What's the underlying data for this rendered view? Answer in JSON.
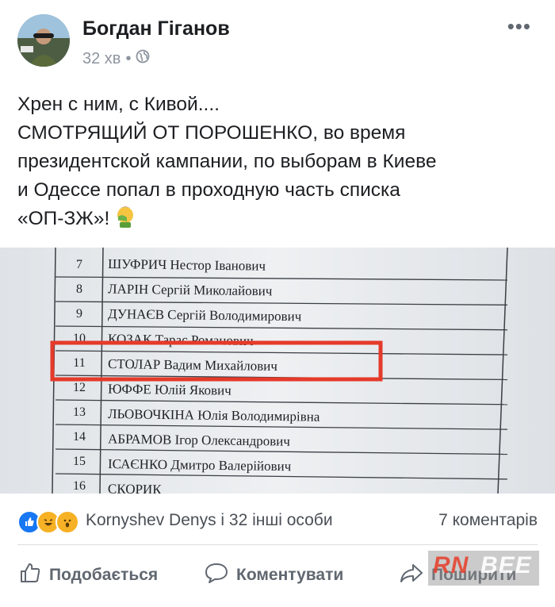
{
  "post": {
    "author": "Богдан Гіганов",
    "time": "32 хв",
    "separator": "•",
    "privacy_icon": "globe-icon",
    "more_label": "•••",
    "text_lines": [
      "Хрен с ним, с Кивой....",
      "СМОТРЯЩИЙ ОТ ПОРОШЕНКО, во время",
      "президентской кампании, по выборам в Киеве",
      "и Одессе попал в проходную часть списка",
      "«ОП-ЗЖ»!"
    ],
    "emoji_icon": "facepalm-emoji-icon"
  },
  "photo": {
    "rows": [
      {
        "num": "7",
        "name": "ШУФРИЧ Нестор Іванович"
      },
      {
        "num": "8",
        "name": "ЛАРІН Сергій Миколайович"
      },
      {
        "num": "9",
        "name": "ДУНАЄВ Сергій Володимирович"
      },
      {
        "num": "10",
        "name": "КОЗАК Тарас Романович"
      },
      {
        "num": "11",
        "name": "СТОЛАР Вадим Михайлович"
      },
      {
        "num": "12",
        "name": "ЮФФЕ Юлій Якович"
      },
      {
        "num": "13",
        "name": "ЛЬОВОЧКІНА Юлія Володимирівна"
      },
      {
        "num": "14",
        "name": "АБРАМОВ Ігор Олександрович"
      },
      {
        "num": "15",
        "name": "ІСАЄНКО Дмитро Валерійович"
      },
      {
        "num": "16",
        "name": "СКОРИК"
      }
    ],
    "highlight_color": "#e53a2a"
  },
  "reactions": {
    "icons": [
      "like-reaction-icon",
      "haha-reaction-icon",
      "wow-reaction-icon"
    ],
    "names": "Kornyshev Denys і 32 інші особи",
    "comments": "7 коментарів"
  },
  "actions": {
    "like": "Подобається",
    "comment": "Коментувати",
    "share": "Поширити"
  },
  "watermark": {
    "left": "RN",
    "right": "BEE"
  }
}
